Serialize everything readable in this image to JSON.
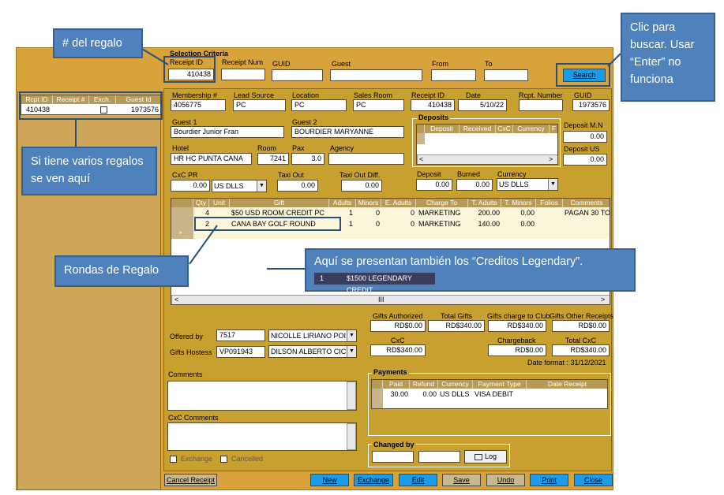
{
  "callouts": {
    "gift_number": "# del regalo",
    "search_click": "Clic para buscar. Usar “Enter” no funciona",
    "multiple_gifts": "Si tiene varios regalos se ven aquí",
    "gift_rounds": "Rondas de Regalo",
    "legendary_credits": "Aquí se presentan también los “Creditos Legendary”.",
    "legendary_row": {
      "qty": "1",
      "gift": "$1500 LEGENDARY CREDIT"
    }
  },
  "criteria": {
    "title": "Selection Criteria",
    "receipt_id_label": "Receipt ID",
    "receipt_id": "410438",
    "receipt_num_label": "Receipt Num",
    "receipt_num": "",
    "guid_label": "GUID",
    "guid": "",
    "guest_label": "Guest",
    "guest": "",
    "from_label": "From",
    "from": "",
    "to_label": "To",
    "to": "",
    "search_button": "Search"
  },
  "receipt_list": {
    "headers": [
      "Rcpt ID",
      "Receipt #",
      "Exch.",
      "Guest Id"
    ],
    "rows": [
      {
        "rcpt_id": "410438",
        "receipt": "",
        "exch": false,
        "guest_id": "1973576"
      }
    ]
  },
  "details": {
    "membership_label": "Membership #",
    "membership": "4056775",
    "lead_source_label": "Lead Source",
    "lead_source": "PC",
    "location_label": "Location",
    "location": "PC",
    "sales_room_label": "Sales Room",
    "sales_room": "PC",
    "receipt_id_label": "Receipt ID",
    "receipt_id": "410438",
    "date_label": "Date",
    "date": "5/10/22",
    "rcpt_number_label": "Rcpt. Number",
    "rcpt_number": "",
    "guid_label": "GUID",
    "guid": "1973576",
    "guest1_label": "Guest 1",
    "guest1": "Bourdier Junior Fran",
    "guest2_label": "Guest 2",
    "guest2": "BOURDIER MARYANNE",
    "hotel_label": "Hotel",
    "hotel": "HR HC PUNTA CANA",
    "room_label": "Room",
    "room": "7241",
    "pax_label": "Pax",
    "pax": "3.0",
    "agency_label": "Agency",
    "agency": "",
    "cxc_pr_label": "CxC PR",
    "cxc_pr": "0.00",
    "cxc_pr_currency": "US DLLS",
    "taxi_out_label": "Taxi Out",
    "taxi_out": "0.00",
    "taxi_out_diff_label": "Taxi Out Diff.",
    "taxi_out_diff": "0.00"
  },
  "deposits": {
    "title": "Deposits",
    "headers": [
      "Deposit",
      "Received",
      "CxC",
      "Currency",
      "F"
    ],
    "deposit_mn_label": "Deposit M.N",
    "deposit_mn": "0.00",
    "deposit_us_label": "Deposit US",
    "deposit_us": "0.00",
    "deposit_label": "Deposit",
    "deposit": "0.00",
    "burned_label": "Burned",
    "burned": "0.00",
    "currency_label": "Currency",
    "currency": "US DLLS"
  },
  "gifts": {
    "headers": [
      "Qty",
      "Unit",
      "Gift",
      "Adults",
      "Minors",
      "E. Adults",
      "Charge To",
      "T. Adults",
      "T. Minors",
      "Folios",
      "Comments"
    ],
    "rows": [
      {
        "qty": "4",
        "unit": "",
        "gift": "$50 USD ROOM CREDIT PC",
        "adults": "1",
        "minors": "0",
        "e_adults": "0",
        "charge_to": "MARKETING",
        "t_adults": "200.00",
        "t_minors": "0.00",
        "folios": "",
        "comments": "PAGAN 30 TO"
      },
      {
        "qty": "2",
        "unit": "",
        "gift": "CANA BAY GOLF ROUND",
        "adults": "1",
        "minors": "0",
        "e_adults": "0",
        "charge_to": "MARKETING",
        "t_adults": "140.00",
        "t_minors": "0.00",
        "folios": "",
        "comments": ""
      }
    ],
    "scroll_mark": "III"
  },
  "totals": {
    "gifts_authorized_label": "Gifts Authorized",
    "gifts_authorized": "RD$0.00",
    "total_gifts_label": "Total Gifts",
    "total_gifts": "RD$340.00",
    "gifts_charge_club_label": "Gifts charge to Club",
    "gifts_charge_club": "RD$340.00",
    "gifts_other_receipts_label": "Gifts Other Receipts",
    "gifts_other_receipts": "RD$0.00",
    "cxc_label": "CxC",
    "cxc": "RD$340.00",
    "chargeback_label": "Chargeback",
    "chargeback": "RD$0.00",
    "total_cxc_label": "Total CxC",
    "total_cxc": "RD$340.00",
    "date_format": "Date format : 31/12/2021"
  },
  "staff": {
    "offered_by_label": "Offered by",
    "offered_by_id": "7517",
    "offered_by_name": "NICOLLE LIRIANO POI",
    "hostess_label": "Gifts Hostess",
    "hostess_id": "VP091943",
    "hostess_name": "DILSON ALBERTO CIC"
  },
  "comments": {
    "label": "Comments",
    "value": "",
    "cxc_label": "CxC Comments",
    "cxc_value": ""
  },
  "flags": {
    "exchange_label": "Exchange",
    "exchange": false,
    "cancelled_label": "Cancelled",
    "cancelled": false
  },
  "payments": {
    "title": "Payments",
    "headers": [
      "Paid",
      "Refund",
      "Currency",
      "Payment Type",
      "Date Receipt"
    ],
    "rows": [
      {
        "paid": "30.00",
        "refund": "0.00",
        "currency": "US DLLS",
        "payment_type": "VISA DEBIT",
        "date_receipt": ""
      }
    ]
  },
  "changed_by": {
    "title": "Changed by",
    "user": "",
    "date": "",
    "log_button": "Log"
  },
  "buttons": {
    "cancel_receipt": "Cancel Receipt",
    "new": "New",
    "exchange": "Exchange",
    "edit": "Edit",
    "save": "Save",
    "undo": "Undo",
    "print": "Print",
    "close": "Close"
  },
  "colors": {
    "form": "#d8a33a",
    "panel": "#c8a030",
    "callout": "#4f81bd",
    "button": "#1e9be6"
  }
}
